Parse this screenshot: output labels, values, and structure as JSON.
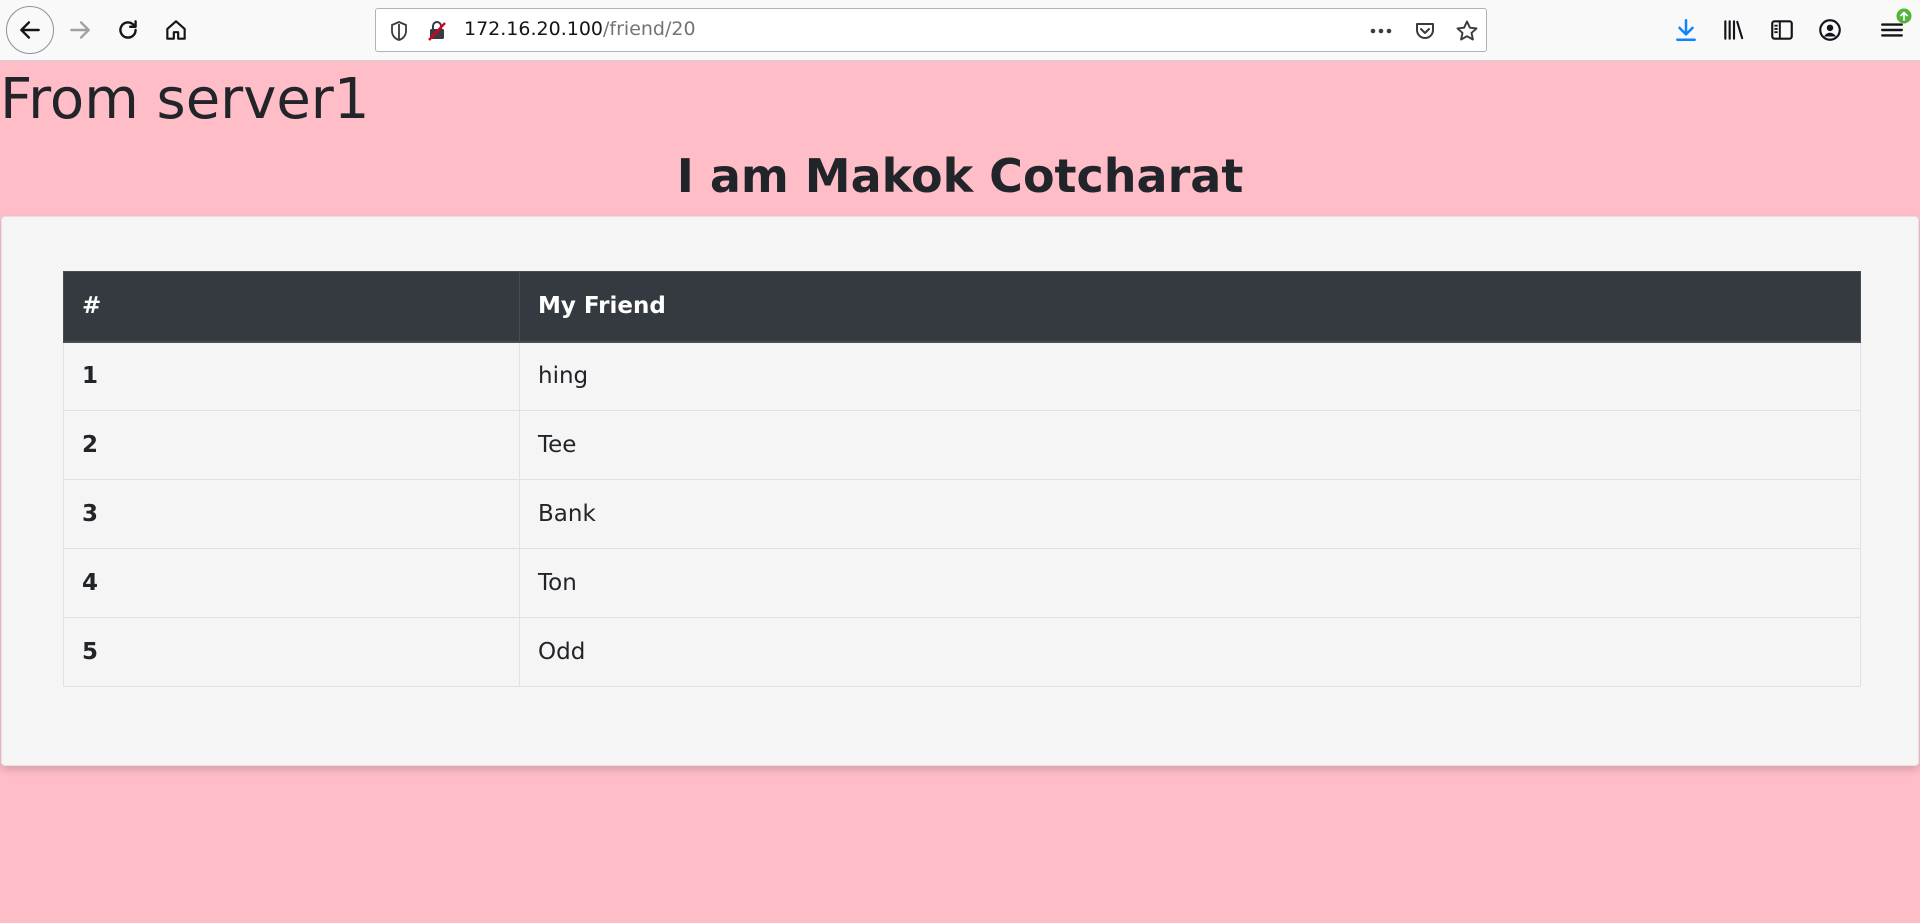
{
  "browser": {
    "url_host": "172.16.20.100",
    "url_path": "/friend/20"
  },
  "page": {
    "server_heading": "From server1",
    "greeting": "I am Makok Cotcharat"
  },
  "table": {
    "headers": [
      "#",
      "My Friend"
    ],
    "rows": [
      {
        "index": "1",
        "name": "hing"
      },
      {
        "index": "2",
        "name": "Tee"
      },
      {
        "index": "3",
        "name": "Bank"
      },
      {
        "index": "4",
        "name": "Ton"
      },
      {
        "index": "5",
        "name": "Odd"
      }
    ]
  },
  "colors": {
    "background": "#ffbdc8",
    "table_header": "#343a40",
    "download_accent": "#0a84ff",
    "update_badge": "#54b435"
  }
}
